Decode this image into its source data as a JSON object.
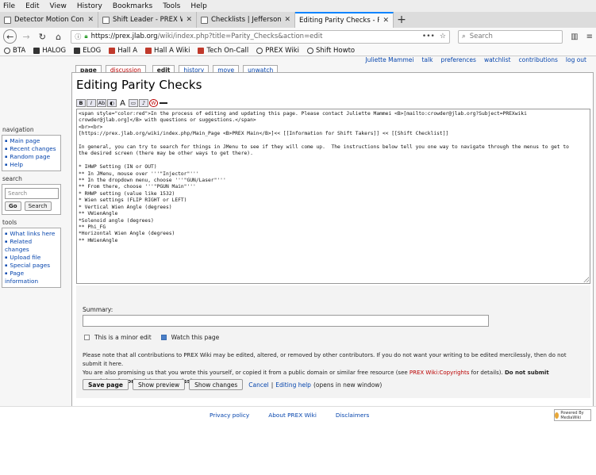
{
  "menubar": [
    "File",
    "Edit",
    "View",
    "History",
    "Bookmarks",
    "Tools",
    "Help"
  ],
  "tabs": [
    {
      "label": "Detector Motion Controls GU",
      "active": false
    },
    {
      "label": "Shift Leader - PREX Wiki",
      "active": false
    },
    {
      "label": "Checklists | Jefferson Lab",
      "active": false
    },
    {
      "label": "Editing Parity Checks - PREX",
      "active": true
    }
  ],
  "url": {
    "host": "https://prex.jlab.org",
    "path": "/wiki/index.php?title=Parity_Checks&action=edit"
  },
  "search_placeholder": "Search",
  "bookmarks": [
    "BTA",
    "HALOG",
    "ELOG",
    "Hall A",
    "Hall A Wiki",
    "Tech On-Call",
    "PREX Wiki",
    "Shift Howto"
  ],
  "personal": [
    "Juliette Mammei",
    "talk",
    "preferences",
    "watchlist",
    "contributions",
    "log out"
  ],
  "page_tabs": [
    "page",
    "discussion",
    "edit",
    "history",
    "move",
    "unwatch"
  ],
  "title": "Editing Parity Checks",
  "editor_lines": [
    "<span style=\"color:red\">In the process of editing and updating this page. Please contact Juliette Mammei <B>[mailto:crowder@jlab.org?Subject=PREXwiki",
    "crowder@jlab.org]</B> with questions or suggestions.</span>",
    "<br><br>",
    "[https://prex.jlab.org/wiki/index.php/Main_Page <B>PREX Main</B>]<< [[Information for Shift Takers]] << [[Shift Checklist]]",
    "",
    "In general, you can try to search for things in JMenu to see if they will come up.  The instructions below tell you one way to navigate through the menus to get to",
    "the desired screen (there may be other ways to get there).",
    "",
    "* IHWP Setting (IN or OUT)",
    "** In JMenu, mouse over '''\"Injector\"'''",
    "** In the dropdown menu, choose '''\"GUN/Laser\"'''",
    "** From there, choose '''\"PGUN Main\"'''",
    "* RHWP setting (value like 1532)",
    "* Wien settings (FLIP RIGHT or LEFT)",
    "* Vertical Wien Angle (degrees)",
    "** VWienAngle",
    "*Solenoid angle (degrees)",
    "** Phi_FG",
    "*Horizontal Wien Angle (degrees)",
    "** HWienAngle"
  ],
  "summary_label": "Summary:",
  "minor_edit_label": "This is a minor edit",
  "watch_label": "Watch this page",
  "notice": {
    "line1": "Please note that all contributions to PREX Wiki may be edited, altered, or removed by other contributors. If you do not want your writing to be edited mercilessly, then do not submit it here.",
    "line2a": "You are also promising us that you wrote this yourself, or copied it from a public domain or similar free resource (see ",
    "line2link": "PREX Wiki:Copyrights",
    "line2b": " for details). ",
    "line2bold": "Do not submit copyrighted work without permission!"
  },
  "buttons": {
    "save": "Save page",
    "preview": "Show preview",
    "changes": "Show changes",
    "cancel": "Cancel",
    "help": "Editing help",
    "newwin": "(opens in new window)"
  },
  "sidebar": {
    "navigation_title": "navigation",
    "navigation": [
      "Main page",
      "Recent changes",
      "Random page",
      "Help"
    ],
    "search_title": "search",
    "search_placeholder": "Search",
    "go": "Go",
    "search": "Search",
    "tools_title": "tools",
    "tools": [
      "What links here",
      "Related changes",
      "Upload file",
      "Special pages",
      "Page information"
    ]
  },
  "footer": [
    "Privacy policy",
    "About PREX Wiki",
    "Disclaimers"
  ],
  "footer_badge": "Powered By MediaWiki"
}
